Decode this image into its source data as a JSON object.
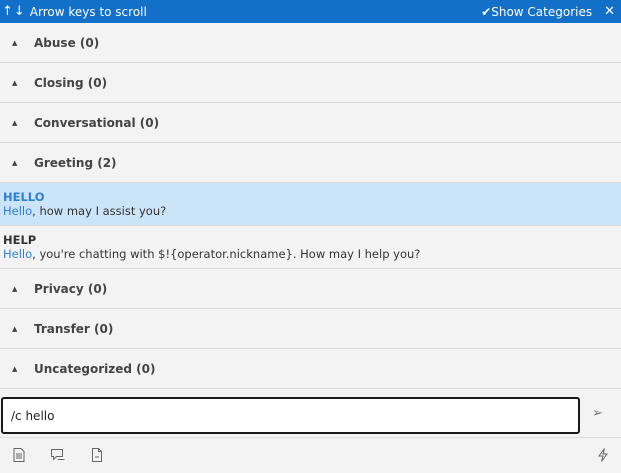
{
  "topbar": {
    "arrows": "↑↓",
    "hint": "Arrow keys to scroll",
    "show_categories_check": "✔",
    "show_categories_label": "Show Categories",
    "close": "✕"
  },
  "categories_before": [
    {
      "label": "Abuse (0)"
    },
    {
      "label": "Closing (0)"
    },
    {
      "label": "Conversational (0)"
    },
    {
      "label": "Greeting (2)"
    }
  ],
  "items": [
    {
      "title": "HELLO",
      "highlight": "Hello",
      "rest": ", how may I assist you?"
    },
    {
      "title": "HELP",
      "highlight": "Hello",
      "rest": ", you're chatting with $!{operator.nickname}. How may I help you?"
    }
  ],
  "categories_after": [
    {
      "label": "Privacy (0)"
    },
    {
      "label": "Transfer (0)"
    },
    {
      "label": "Uncategorized (0)"
    }
  ],
  "input": {
    "value": "/c hello"
  },
  "colors": {
    "accent": "#1370c8",
    "selected_bg": "#cce4f7",
    "highlight": "#2f7fd6"
  },
  "icons": [
    "document-icon",
    "chat-bubble-icon",
    "page-icon",
    "lightning-icon"
  ]
}
